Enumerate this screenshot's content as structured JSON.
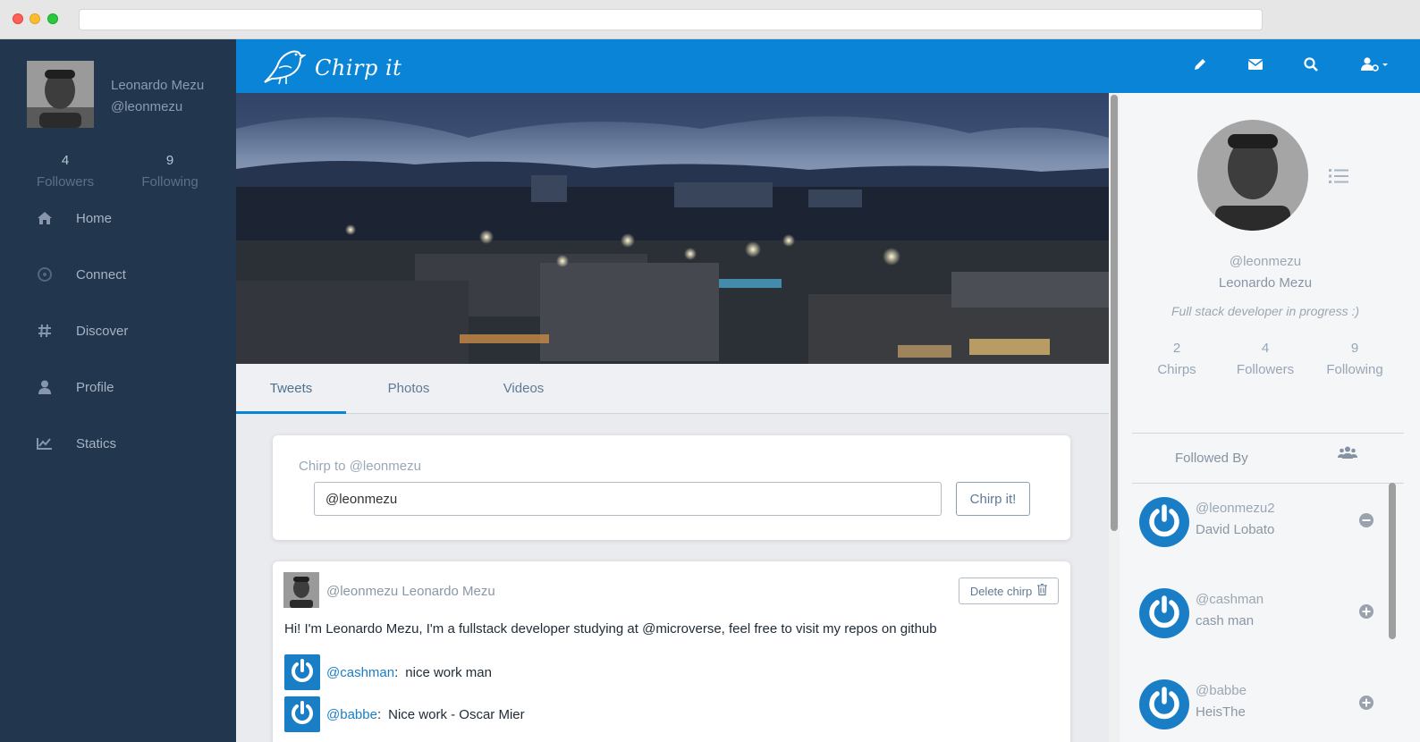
{
  "browser": {
    "url": ""
  },
  "brand": {
    "name": "Chirp it"
  },
  "sidebar": {
    "user": {
      "name": "Leonardo Mezu",
      "handle": "@leonmezu"
    },
    "stats": [
      {
        "value": "4",
        "label": "Followers"
      },
      {
        "value": "9",
        "label": "Following"
      }
    ],
    "nav": [
      {
        "label": "Home",
        "icon": "home-icon"
      },
      {
        "label": "Connect",
        "icon": "connect-icon"
      },
      {
        "label": "Discover",
        "icon": "hash-icon"
      },
      {
        "label": "Profile",
        "icon": "user-icon"
      },
      {
        "label": "Statics",
        "icon": "chart-icon"
      }
    ]
  },
  "topbar": {
    "icons": [
      "pencil-icon",
      "envelope-icon",
      "search-icon",
      "user-settings-icon"
    ]
  },
  "tabs": [
    {
      "label": "Tweets",
      "active": true
    },
    {
      "label": "Photos",
      "active": false
    },
    {
      "label": "Videos",
      "active": false
    }
  ],
  "compose": {
    "title": "Chirp to @leonmezu",
    "value": "@leonmezu",
    "button": "Chirp it!"
  },
  "post": {
    "author": "@leonmezu Leonardo Mezu",
    "delete_label": "Delete chirp",
    "body": "Hi! I'm Leonardo Mezu, I'm a fullstack developer studying at @microverse, feel free to visit my repos on github",
    "replies": [
      {
        "user": "@cashman",
        "sep": ":",
        "text": "nice work man"
      },
      {
        "user": "@babbe",
        "sep": ":",
        "text": "Nice work - Oscar Mier"
      }
    ]
  },
  "profile": {
    "handle": "@leonmezu",
    "name": "Leonardo Mezu",
    "bio": "Full stack developer in progress :)",
    "stats": [
      {
        "value": "2",
        "label": "Chirps"
      },
      {
        "value": "4",
        "label": "Followers"
      },
      {
        "value": "9",
        "label": "Following"
      }
    ]
  },
  "followed_by": {
    "title": "Followed By",
    "items": [
      {
        "handle": "@leonmezu2",
        "name": "David Lobato",
        "action": "remove"
      },
      {
        "handle": "@cashman",
        "name": "cash man",
        "action": "add"
      },
      {
        "handle": "@babbe",
        "name": "HeisThe",
        "action": "add"
      }
    ]
  },
  "colors": {
    "accent": "#0a84d6",
    "sidebar": "#22364d",
    "link": "#1a7ec6"
  }
}
